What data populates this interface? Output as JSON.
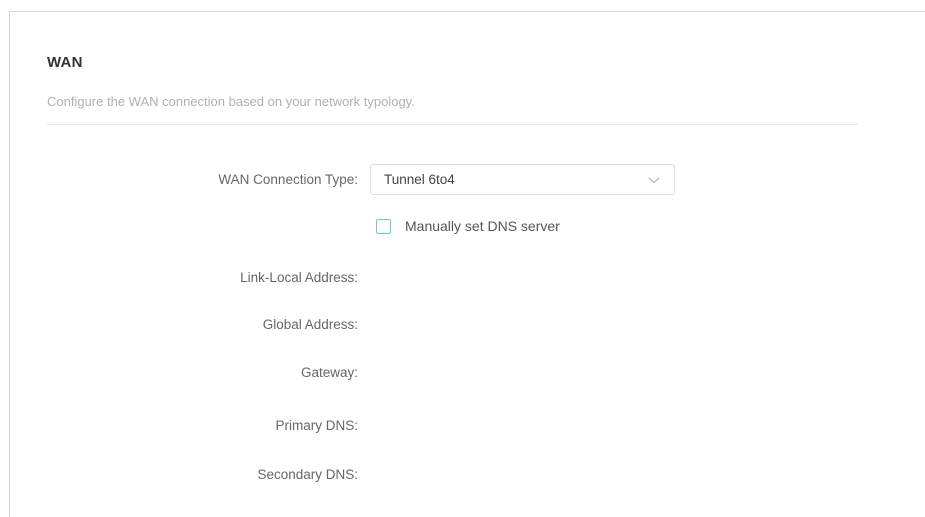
{
  "section": {
    "title": "WAN",
    "description": "Configure the WAN connection based on your network typology."
  },
  "connection_type": {
    "label": "WAN Connection Type:",
    "value": "Tunnel 6to4",
    "icon": "chevron-down-icon"
  },
  "dns_manual": {
    "label": "Manually set DNS server",
    "checked": false
  },
  "fields": {
    "link_local": "Link-Local Address:",
    "global": "Global Address:",
    "gateway": "Gateway:",
    "primary_dns": "Primary DNS:",
    "secondary_dns": "Secondary DNS:"
  },
  "colors": {
    "accent": "#6fc6cf",
    "label": "#666666",
    "description": "#b0b0b0"
  }
}
